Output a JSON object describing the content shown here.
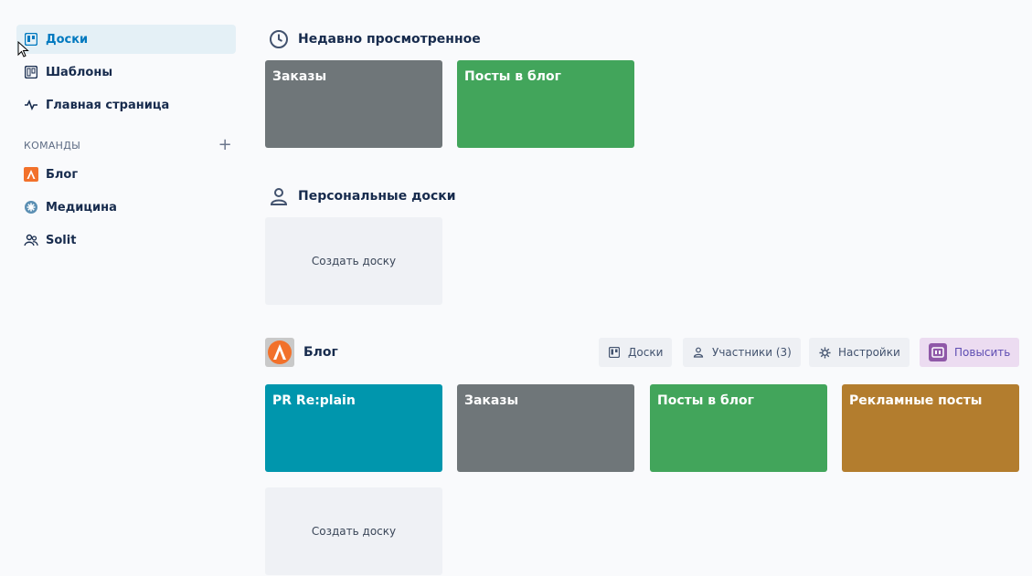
{
  "sidebar": {
    "nav": [
      {
        "label": "Доски",
        "icon": "boards-icon",
        "active": true
      },
      {
        "label": "Шаблоны",
        "icon": "templates-icon"
      },
      {
        "label": "Главная страница",
        "icon": "activity-icon"
      }
    ],
    "teams_header": "КОМАНДЫ",
    "add_team_label": "+",
    "teams": [
      {
        "label": "Блог",
        "icon": "blog-logo-icon"
      },
      {
        "label": "Медицина",
        "icon": "medicine-icon"
      },
      {
        "label": "Solit",
        "icon": "solit-icon"
      }
    ]
  },
  "recent": {
    "title": "Недавно просмотренное",
    "boards": [
      {
        "title": "Заказы",
        "color": "#6f7679"
      },
      {
        "title": "Посты в блог",
        "color": "#42a55b"
      }
    ]
  },
  "personal": {
    "title": "Персональные доски",
    "create_label": "Создать доску"
  },
  "team_blog": {
    "title": "Блог",
    "buttons": {
      "boards": "Доски",
      "members": "Участники (3)",
      "settings": "Настройки",
      "upgrade": "Повысить"
    },
    "boards": [
      {
        "title": "PR Re:plain",
        "color": "#0096ad"
      },
      {
        "title": "Заказы",
        "color": "#6f7679"
      },
      {
        "title": "Посты в блог",
        "color": "#42a55b"
      },
      {
        "title": "Рекламные посты",
        "color": "#b37d2e"
      }
    ],
    "create_label": "Создать доску"
  },
  "colors": {
    "accent": "#0079bf",
    "active_bg": "#e4f0f6",
    "blog_logo": "#f2712b"
  }
}
